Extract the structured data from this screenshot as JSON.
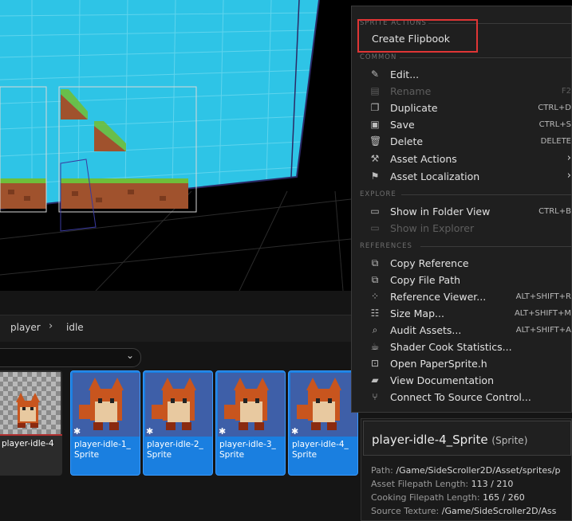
{
  "breadcrumb": {
    "items": [
      "player",
      "idle"
    ]
  },
  "tiles": [
    {
      "label": "player-idle-4",
      "selected": false
    },
    {
      "label": "player-idle-1_ Sprite",
      "selected": true
    },
    {
      "label": "player-idle-2_ Sprite",
      "selected": true
    },
    {
      "label": "player-idle-3_ Sprite",
      "selected": true
    },
    {
      "label": "player-idle-4_ Sprite",
      "selected": true
    }
  ],
  "menu": {
    "sections": {
      "sprite_actions": "SPRITE ACTIONS",
      "common": "COMMON",
      "explore": "EXPLORE",
      "references": "REFERENCES"
    },
    "create_flipbook": "Create Flipbook",
    "edit": "Edit...",
    "rename": "Rename",
    "rename_shortcut": "F2",
    "duplicate": "Duplicate",
    "duplicate_shortcut": "CTRL+D",
    "save": "Save",
    "save_shortcut": "CTRL+S",
    "delete": "Delete",
    "delete_shortcut": "DELETE",
    "asset_actions": "Asset Actions",
    "asset_localization": "Asset Localization",
    "show_in_folder_view": "Show in Folder View",
    "show_in_folder_view_shortcut": "CTRL+B",
    "show_in_explorer": "Show in Explorer",
    "copy_reference": "Copy Reference",
    "copy_file_path": "Copy File Path",
    "reference_viewer": "Reference Viewer...",
    "reference_viewer_shortcut": "ALT+SHIFT+R",
    "size_map": "Size Map...",
    "size_map_shortcut": "ALT+SHIFT+M",
    "audit_assets": "Audit Assets...",
    "audit_assets_shortcut": "ALT+SHIFT+A",
    "shader_cook_statistics": "Shader Cook Statistics...",
    "open_papersprite": "Open PaperSprite.h",
    "view_documentation": "View Documentation",
    "connect_source_control": "Connect To Source Control..."
  },
  "details": {
    "name": "player-idle-4_Sprite",
    "type": "(Sprite)",
    "path_label": "Path:",
    "path_value": "/Game/SideScroller2D/Asset/sprites/p",
    "asset_filepath_label": "Asset Filepath Length:",
    "asset_filepath_value": "113 / 210",
    "cooking_filepath_label": "Cooking Filepath Length:",
    "cooking_filepath_value": "165 / 260",
    "source_texture_label": "Source Texture:",
    "source_texture_value": "/Game/SideScroller2D/Ass"
  },
  "colors": {
    "accent": "#1a7fe0",
    "highlight": "#e03535",
    "water": "#2ec4e6"
  }
}
